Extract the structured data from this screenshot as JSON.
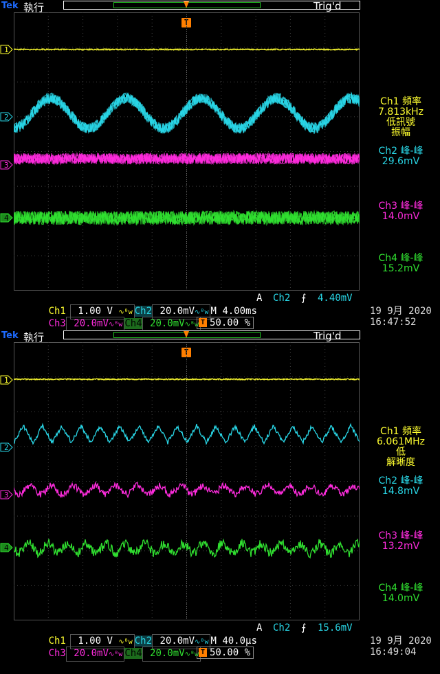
{
  "colors": {
    "ch1": "#ffff30",
    "ch2": "#29d7e7",
    "ch3": "#ff2cde",
    "ch4": "#30e030",
    "trigger": "#ff7f00",
    "brand": "#1e6bff"
  },
  "screens": [
    {
      "brand": "Tek",
      "run": "執行",
      "trig_status": "Trig'd",
      "marker_t": "T",
      "ch_labels": [
        "1",
        "2",
        "3",
        "4"
      ],
      "meas": {
        "ch1_title": "Ch1 頻率",
        "ch1_value": "7.813kHz",
        "ch1_note1": "低訊號",
        "ch1_note2": "振幅",
        "ch2_title": "Ch2 峰-峰",
        "ch2_value": "29.6mV",
        "ch3_title": "Ch3 峰-峰",
        "ch3_value": "14.0mV",
        "ch4_title": "Ch4 峰-峰",
        "ch4_value": "15.2mV"
      },
      "bottom": {
        "ch1": "Ch1",
        "ch1_scale": " 1.00 V ",
        "ch2": "Ch2",
        "ch2_scale": " 20.0mV",
        "timebase": "M 4.00ms",
        "acq": "A",
        "trig_src": "Ch2",
        "trig_level": "4.40mV",
        "ch3": "Ch3",
        "ch3_scale": " 20.0mV",
        "ch4": "Ch4",
        "ch4_scale": " 20.0mV",
        "trig_pct": "50.00 %",
        "date": "19 9月  2020",
        "time": "16:47:52"
      }
    },
    {
      "brand": "Tek",
      "run": "執行",
      "trig_status": "Trig'd",
      "marker_t": "T",
      "ch_labels": [
        "1",
        "2",
        "3",
        "4"
      ],
      "meas": {
        "ch1_title": "Ch1 頻率",
        "ch1_value": "6.061MHz",
        "ch1_note1": "低",
        "ch1_note2": "解晰度",
        "ch2_title": "Ch2 峰-峰",
        "ch2_value": "14.8mV",
        "ch3_title": "Ch3 峰-峰",
        "ch3_value": "13.2mV",
        "ch4_title": "Ch4 峰-峰",
        "ch4_value": "14.0mV"
      },
      "bottom": {
        "ch1": "Ch1",
        "ch1_scale": " 1.00 V ",
        "ch2": "Ch2",
        "ch2_scale": " 20.0mV",
        "timebase": "M 40.0µs",
        "acq": "A",
        "trig_src": "Ch2",
        "trig_level": "15.6mV",
        "ch3": "Ch3",
        "ch3_scale": " 20.0mV",
        "ch4": "Ch4",
        "ch4_scale": " 20.0mV",
        "trig_pct": "50.00 %",
        "date": "19 9月  2020",
        "time": "16:49:04"
      }
    }
  ]
}
